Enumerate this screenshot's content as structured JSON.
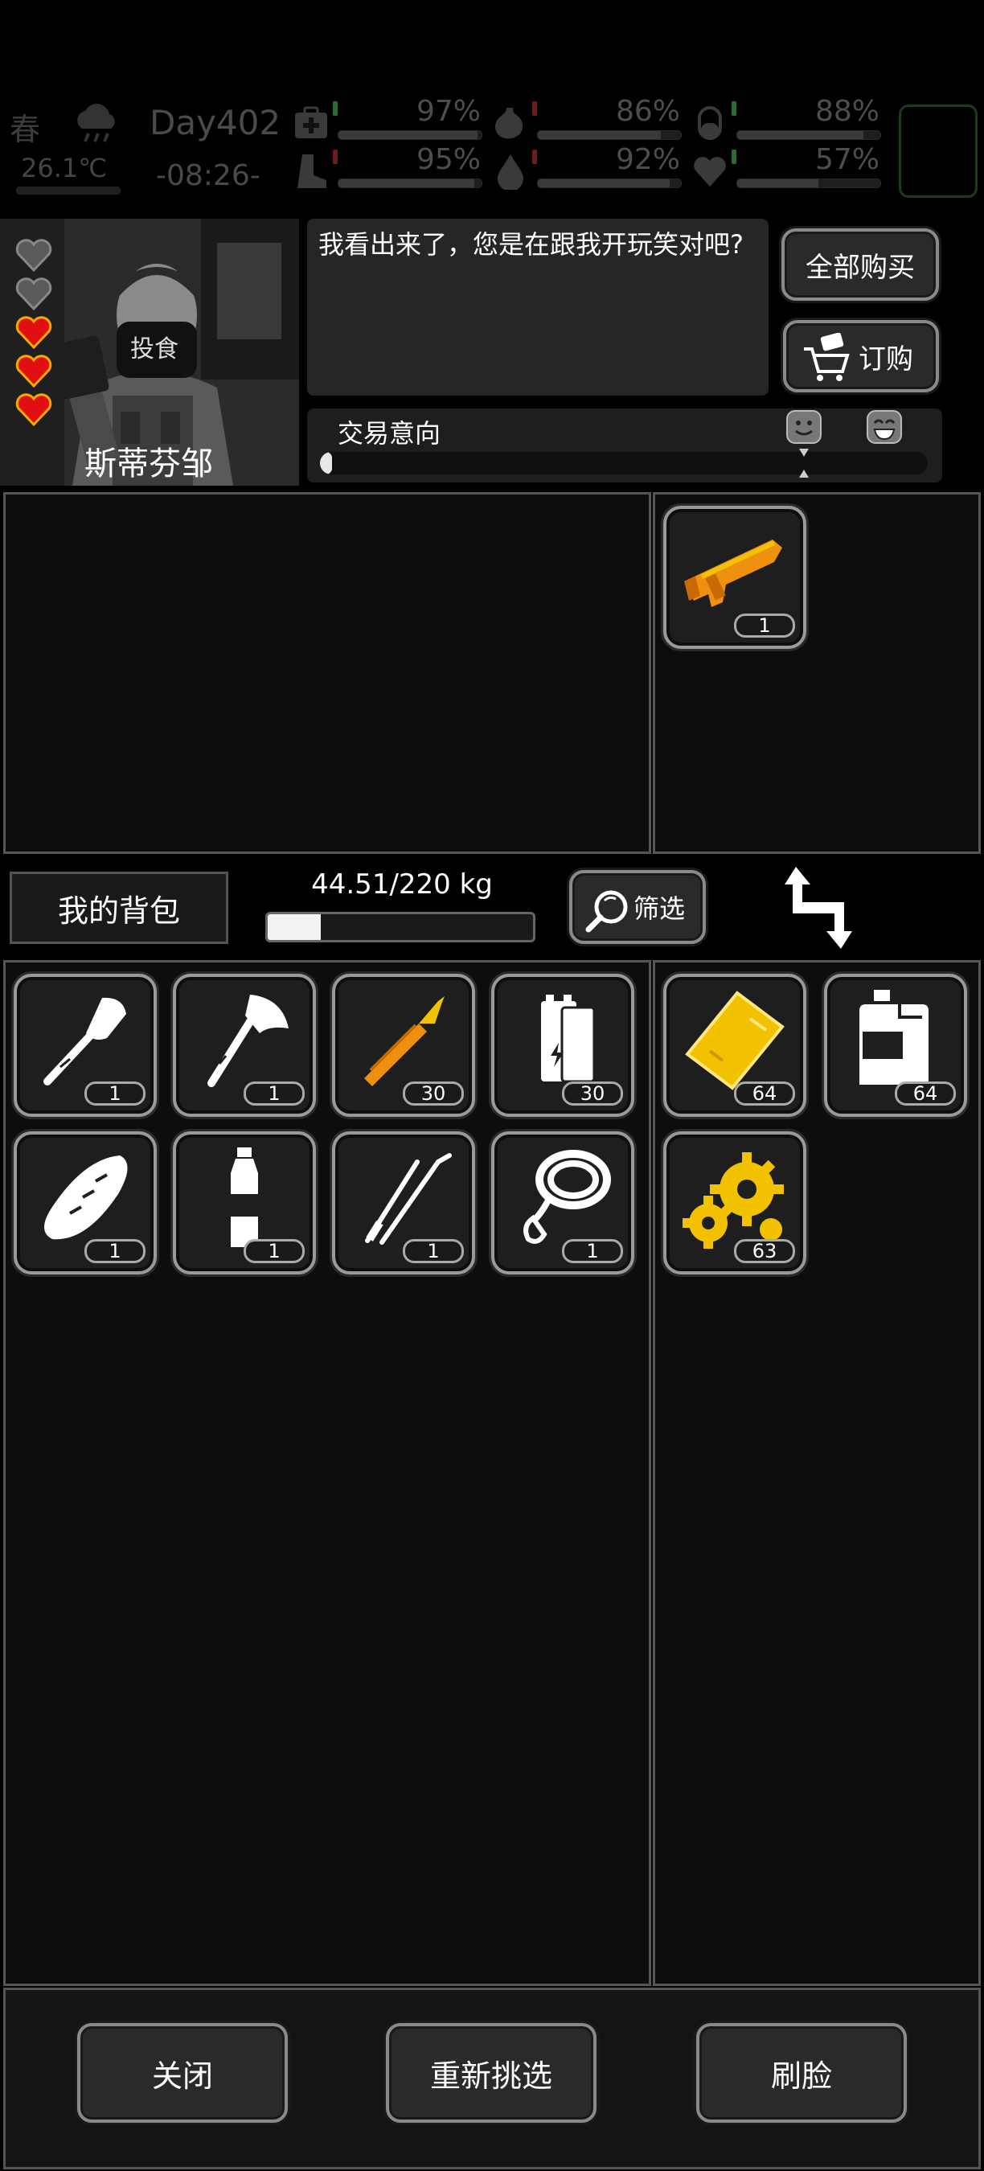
{
  "hud": {
    "season": "春",
    "temperature": "26.1℃",
    "day": "Day402",
    "time": "-08:26-",
    "stats": [
      {
        "icon": "medkit-icon",
        "value": "97%",
        "level": 0.97,
        "arrow_color": "#2e6b2e"
      },
      {
        "icon": "stomach-icon",
        "value": "86%",
        "level": 0.86,
        "arrow_color": "#6b1e1e"
      },
      {
        "icon": "pill-icon",
        "value": "88%",
        "level": 0.88,
        "arrow_color": "#2e6b2e"
      },
      {
        "icon": "boot-icon",
        "value": "95%",
        "level": 0.95,
        "arrow_color": "#6b1e1e"
      },
      {
        "icon": "water-drop-icon",
        "value": "92%",
        "level": 0.92,
        "arrow_color": "#6b1e1e"
      },
      {
        "icon": "heart-icon",
        "value": "57%",
        "level": 0.57,
        "arrow_color": "#2e6b2e"
      }
    ]
  },
  "merchant": {
    "name": "斯蒂芬邹",
    "mask_text": "投食",
    "dialog": "我看出来了，您是在跟我开玩笑对吧?",
    "hearts_filled": 3,
    "hearts_total": 5,
    "buy_all_label": "全部购买",
    "order_label": "订购",
    "intent_label": "交易意向",
    "intent_level": 0.02
  },
  "trade": {
    "merchant_items": [
      {
        "icon": "orange-shotgun-icon",
        "count": "1"
      }
    ]
  },
  "inventory": {
    "title": "我的背包",
    "weight": "44.51/220 kg",
    "weight_level": 0.2,
    "filter_label": "筛选",
    "items": [
      {
        "icon": "shovel-icon",
        "count": "1"
      },
      {
        "icon": "axe-icon",
        "count": "1"
      },
      {
        "icon": "bullet-icon",
        "count": "30"
      },
      {
        "icon": "battery-icon",
        "count": "30"
      }
    ],
    "items_row2": [
      {
        "icon": "bread-icon",
        "count": "1"
      },
      {
        "icon": "water-bottle-icon",
        "count": "1"
      },
      {
        "icon": "tweezers-icon",
        "count": "1"
      },
      {
        "icon": "rope-icon",
        "count": "1"
      }
    ],
    "side_items": [
      {
        "icon": "gold-plate-icon",
        "count": "64"
      },
      {
        "icon": "fuel-can-icon",
        "count": "64"
      },
      {
        "icon": "gears-icon",
        "count": "63"
      }
    ]
  },
  "footer": {
    "close_label": "关闭",
    "reroll_label": "重新挑选",
    "refresh_label": "刷脸"
  },
  "colors": {
    "heart_red": "#e01010",
    "heart_gold": "#f2a900",
    "item_gold": "#f2c200",
    "item_orange": "#f09010"
  }
}
